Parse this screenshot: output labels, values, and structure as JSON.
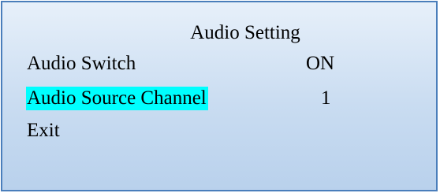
{
  "menu": {
    "title": "Audio Setting",
    "items": [
      {
        "label": "Audio Switch",
        "value": "ON",
        "selected": false
      },
      {
        "label": "Audio Source Channel",
        "value": "1",
        "selected": true
      },
      {
        "label": "Exit",
        "value": "",
        "selected": false
      }
    ]
  },
  "colors": {
    "highlight": "#00ffff",
    "border": "#4a7ebb",
    "background_top": "#e7f0fa",
    "background_bottom": "#b9d1ec"
  }
}
